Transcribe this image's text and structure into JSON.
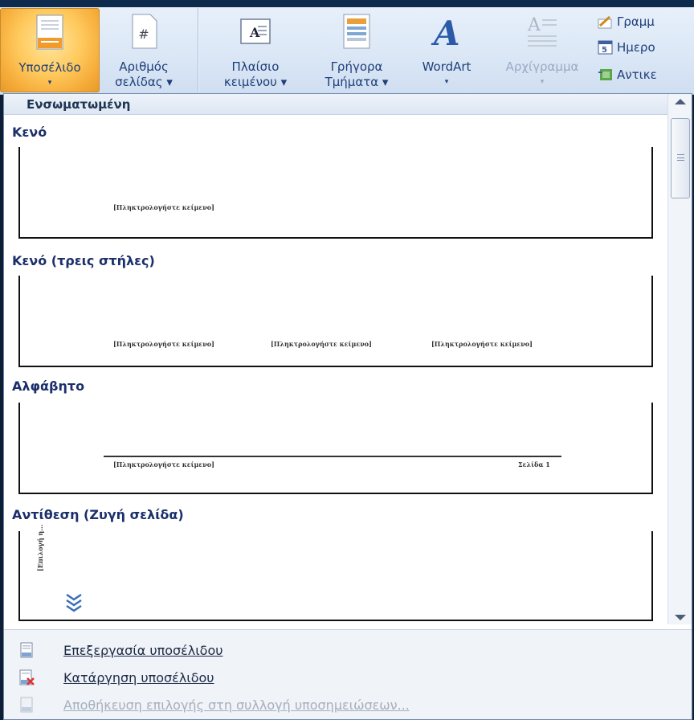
{
  "ribbon": {
    "footer_button": {
      "label": "Υποσέλιδο",
      "dropdown": "▾"
    },
    "page_number_button": {
      "label_line1": "Αριθμός",
      "label_line2": "σελίδας ▾"
    },
    "textbox_button": {
      "label_line1": "Πλαίσιο",
      "label_line2": "κειμένου ▾"
    },
    "quickparts_button": {
      "label_line1": "Γρήγορα",
      "label_line2": "Τμήματα ▾"
    },
    "wordart_button": {
      "label_line1": "WordArt",
      "label_line2": "▾"
    },
    "dropcap_button": {
      "label_line1": "Αρχίγραμμα",
      "label_line2": "▾"
    },
    "small_buttons": [
      {
        "label": "Γραμμ"
      },
      {
        "label": "Ημερο"
      },
      {
        "label": "Αντικε"
      }
    ]
  },
  "gallery": {
    "header": "Ενσωματωμένη",
    "sections": [
      {
        "title": "Κενό",
        "placeholders": [
          "[Πληκτρολογήστε κείμενο]"
        ]
      },
      {
        "title": "Κενό (τρεις στήλες)",
        "placeholders": [
          "[Πληκτρολογήστε κείμενο]",
          "[Πληκτρολογήστε κείμενο]",
          "[Πληκτρολογήστε κείμενο]"
        ]
      },
      {
        "title": "Αλφάβητο",
        "placeholders": [
          "[Πληκτρολογήστε κείμενο]",
          "Σελίδα 1"
        ]
      },
      {
        "title": "Αντίθεση (Ζυγή σελίδα)",
        "placeholders": [
          "[Επιλογή η..."
        ]
      }
    ]
  },
  "menu": {
    "edit_footer": "Επεξεργασία υποσέλιδου",
    "remove_footer": "Κατάργηση υποσέλιδου",
    "save_selection": "Αποθήκευση επιλογής στη συλλογή υποσημειώσεων..."
  }
}
